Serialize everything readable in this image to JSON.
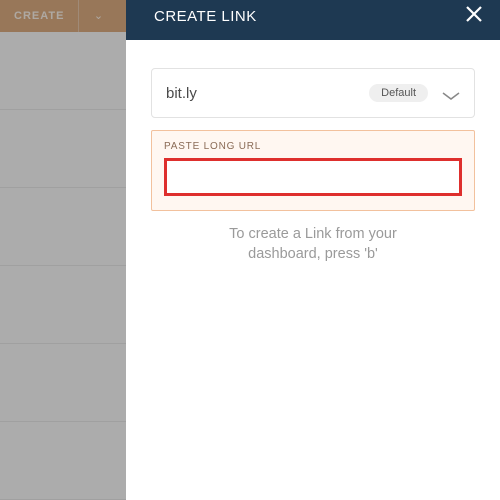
{
  "background": {
    "create_label": "CREATE"
  },
  "modal": {
    "title": "CREATE LINK",
    "domain": {
      "value": "bit.ly",
      "badge": "Default"
    },
    "url_section": {
      "label": "PASTE LONG URL",
      "value": ""
    },
    "help_line1": "To create a Link from your",
    "help_line2": "dashboard, press 'b'"
  }
}
